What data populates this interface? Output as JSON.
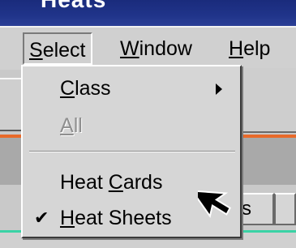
{
  "window": {
    "title": "Heats"
  },
  "menubar": {
    "select_first": "S",
    "select_rest": "elect",
    "window_first": "W",
    "window_rest": "indow",
    "help_first": "H",
    "help_rest": "elp"
  },
  "select_menu": {
    "class_first": "C",
    "class_rest": "lass",
    "all_first": "A",
    "all_rest": "ll",
    "heat_cards_prefix": "Heat ",
    "heat_cards_first": "C",
    "heat_cards_rest": "ards",
    "heat_sheets_first": "H",
    "heat_sheets_rest": "eat Sheets",
    "heat_sheets_checked": true
  },
  "background": {
    "tab_partial_text": "ss"
  },
  "icons": {
    "submenu_arrow": "chevron-right-icon",
    "checkmark": "check-icon",
    "cursor": "mouse-pointer-icon"
  },
  "colors": {
    "title_bar": "#20348a",
    "menu_bg": "#d6d6d6",
    "accent_line": "#e86a2a",
    "status_line": "#3ad3a5"
  }
}
